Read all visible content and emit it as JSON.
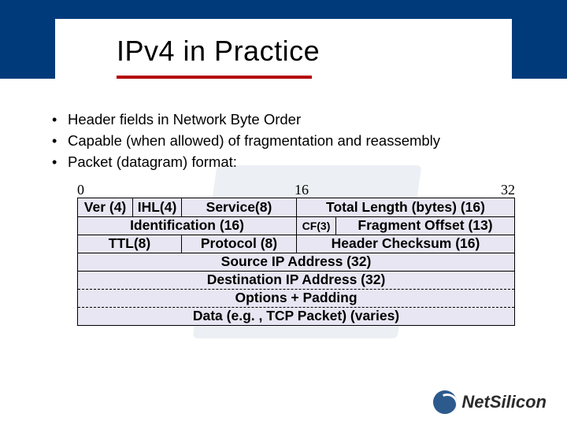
{
  "title": "IPv4 in Practice",
  "bullets": [
    "Header fields in Network Byte Order",
    "Capable (when allowed) of fragmentation and reassembly",
    "Packet (datagram) format:"
  ],
  "bit_labels": {
    "left": "0",
    "mid": "16",
    "right": "32"
  },
  "header_rows": {
    "r1": {
      "ver": "Ver (4)",
      "ihl": "IHL(4)",
      "service": "Service(8)",
      "total_len": "Total Length (bytes) (16)"
    },
    "r2": {
      "ident": "Identification (16)",
      "cf": "CF(3)",
      "frag": "Fragment Offset (13)"
    },
    "r3": {
      "ttl": "TTL(8)",
      "proto": "Protocol (8)",
      "checksum": "Header Checksum (16)"
    },
    "r4": "Source IP Address (32)",
    "r5": "Destination IP Address (32)",
    "r6": "Options + Padding",
    "r7": "Data (e.g. , TCP Packet) (varies)"
  },
  "logo": {
    "brand_a": "Net",
    "brand_b": "Silicon"
  }
}
